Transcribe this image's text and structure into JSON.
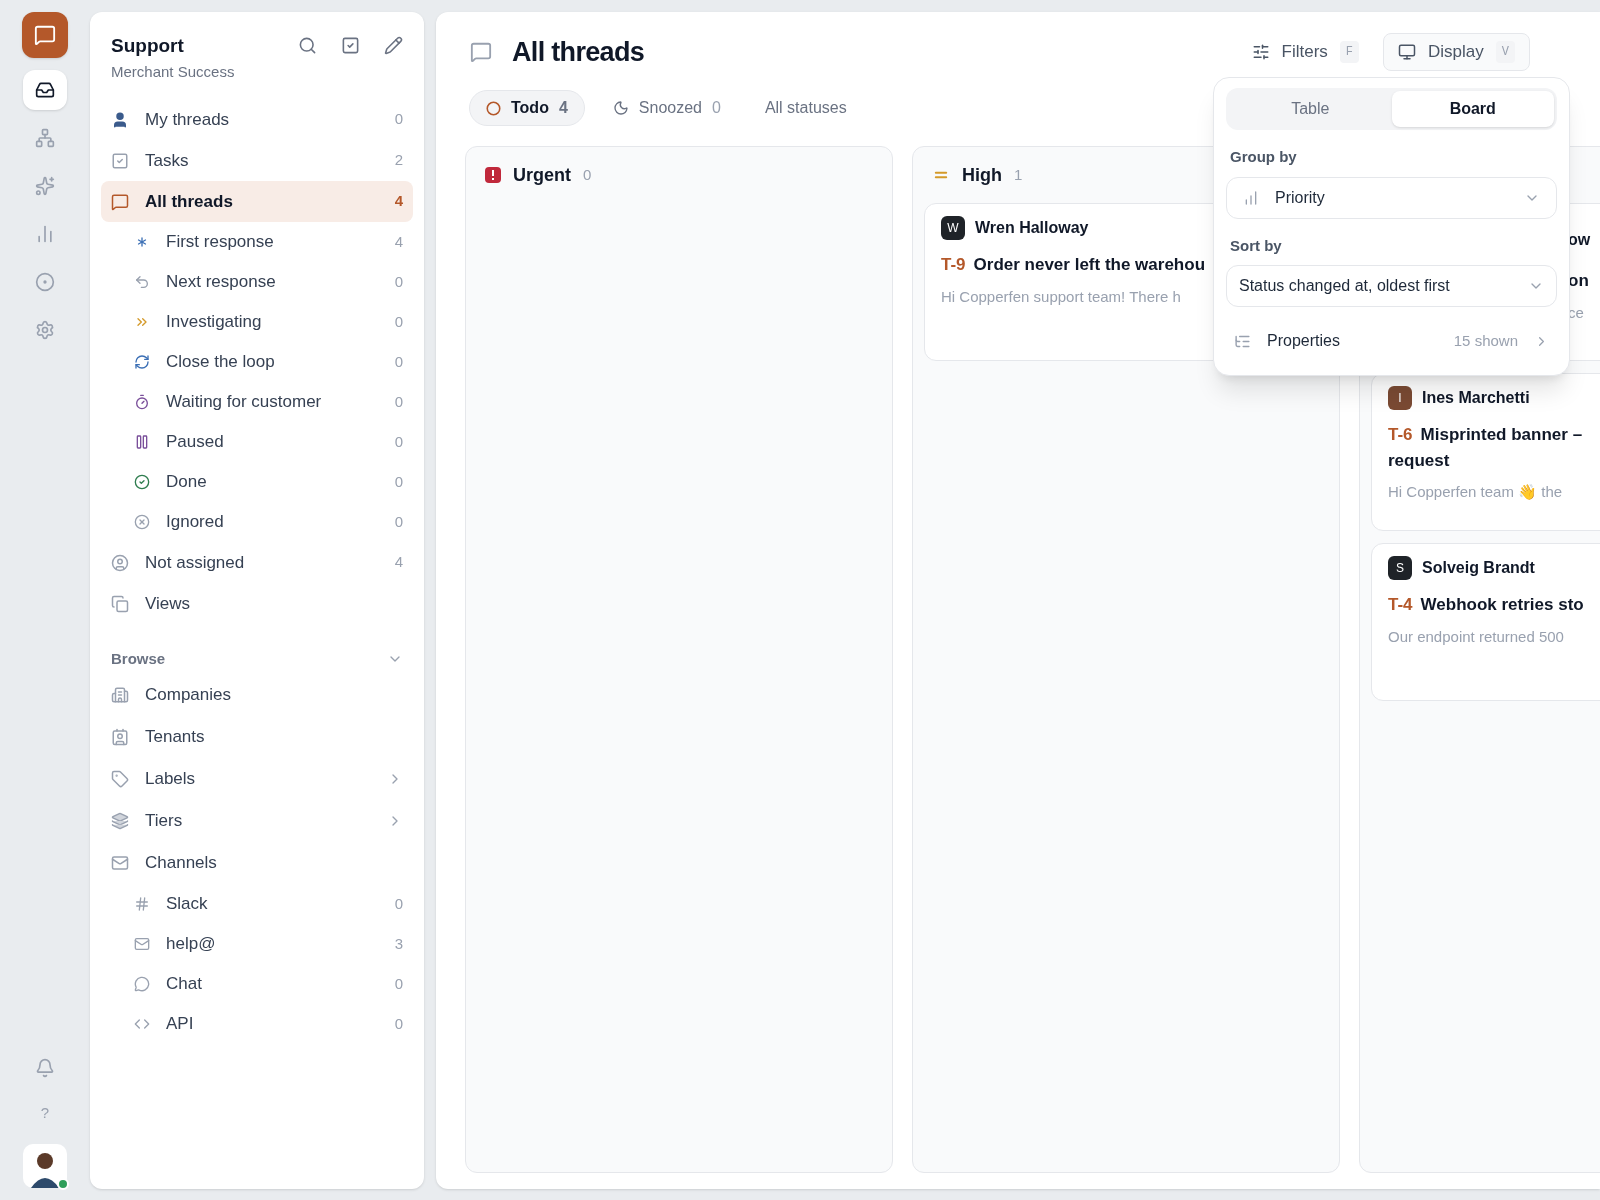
{
  "rail": {
    "items": [
      {
        "selected": true
      },
      {
        "selected": false
      },
      {
        "selected": false
      },
      {
        "selected": false
      },
      {
        "selected": false
      },
      {
        "selected": false
      }
    ],
    "help": "?"
  },
  "sidebar": {
    "title": "Support",
    "subtitle": "Merchant Success",
    "items": [
      {
        "label": "My threads",
        "count": "0",
        "selected": false
      },
      {
        "label": "Tasks",
        "count": "2",
        "selected": false
      },
      {
        "label": "All threads",
        "count": "4",
        "selected": true,
        "children": [
          {
            "label": "First response",
            "count": "4",
            "selected": false
          },
          {
            "label": "Next response",
            "count": "0",
            "selected": false
          },
          {
            "label": "Investigating",
            "count": "0",
            "selected": false
          },
          {
            "label": "Close the loop",
            "count": "0",
            "selected": false
          },
          {
            "label": "Waiting for customer",
            "count": "0",
            "selected": false
          },
          {
            "label": "Paused",
            "count": "0",
            "selected": false
          },
          {
            "label": "Done",
            "count": "0",
            "selected": false
          },
          {
            "label": "Ignored",
            "count": "0",
            "selected": false
          }
        ]
      },
      {
        "label": "Not assigned",
        "count": "4",
        "selected": false
      },
      {
        "label": "Views",
        "selected": false
      }
    ],
    "browse": {
      "title": "Browse",
      "expanded": true,
      "items": [
        {
          "label": "Companies",
          "kind": "link"
        },
        {
          "label": "Tenants",
          "kind": "link"
        },
        {
          "label": "Labels",
          "kind": "submenu"
        },
        {
          "label": "Tiers",
          "kind": "submenu"
        },
        {
          "label": "Channels",
          "kind": "link",
          "children": [
            {
              "label": "Slack",
              "count": "0"
            },
            {
              "label": "help@",
              "count": "3"
            },
            {
              "label": "Chat",
              "count": "0"
            },
            {
              "label": "API",
              "count": "0"
            }
          ]
        }
      ]
    }
  },
  "main": {
    "title": "All threads",
    "filters": {
      "label": "Filters",
      "shortcut": "F"
    },
    "display": {
      "label": "Display",
      "shortcut": "V"
    },
    "tabs": [
      {
        "label": "Todo",
        "count": "4",
        "selected": true
      },
      {
        "label": "Snoozed",
        "count": "0",
        "selected": false
      },
      {
        "label": "All statuses",
        "selected": false
      }
    ],
    "columns": [
      {
        "kind": "urgent",
        "title": "Urgent",
        "count": "0"
      },
      {
        "kind": "high",
        "title": "High",
        "count": "1",
        "cards": [
          {
            "initial": "W",
            "color": "#1f2328",
            "name": "Wren Halloway",
            "id": "T-9",
            "title": [
              "Order never left the warehou"
            ],
            "preview": "Hi Copperfen support team! There h"
          }
        ]
      },
      {
        "kind": "hidden",
        "cards": [
          {
            "kind": "partial",
            "name": "ow",
            "title": [
              "on"
            ],
            "preview": "ce"
          },
          {
            "kind": "full",
            "initial": "I",
            "color": "#7a4a33",
            "name": "Ines Marchetti",
            "id": "T-6",
            "title": [
              "Misprinted banner –",
              "request"
            ],
            "preview": "Hi Copperfen team 👋 the"
          },
          {
            "kind": "full",
            "initial": "S",
            "color": "#1f2328",
            "name": "Solveig Brandt",
            "id": "T-4",
            "title": [
              "Webhook retries sto"
            ],
            "preview": "Our endpoint returned 500"
          }
        ]
      }
    ]
  },
  "display_menu": {
    "views": [
      {
        "label": "Table",
        "selected": false
      },
      {
        "label": "Board",
        "selected": true
      }
    ],
    "group_by": {
      "label": "Group by",
      "value": "Priority"
    },
    "sort_by": {
      "label": "Sort by",
      "value": "Status changed at, oldest first"
    },
    "properties": {
      "label": "Properties",
      "value": "15 shown"
    }
  }
}
